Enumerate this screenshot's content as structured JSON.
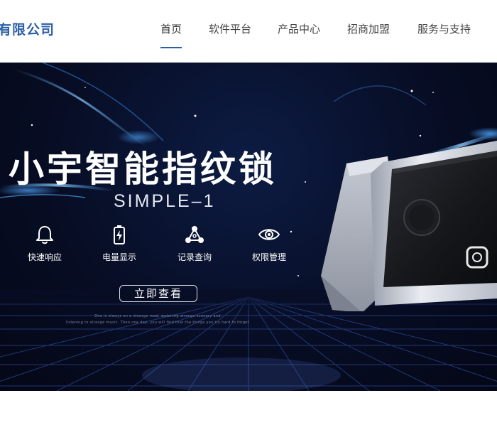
{
  "header": {
    "logo_text": "有限公司",
    "nav": [
      {
        "label": "首页",
        "active": true
      },
      {
        "label": "软件平台",
        "active": false
      },
      {
        "label": "产品中心",
        "active": false
      },
      {
        "label": "招商加盟",
        "active": false
      },
      {
        "label": "服务与支持",
        "active": false
      }
    ]
  },
  "hero": {
    "title": "小宇智能指纹锁",
    "subtitle": "SIMPLE–1",
    "features": [
      {
        "label": "快速响应",
        "icon": "bell-icon"
      },
      {
        "label": "电量显示",
        "icon": "battery-icon"
      },
      {
        "label": "记录查询",
        "icon": "share-nodes-icon"
      },
      {
        "label": "权限管理",
        "icon": "eye-icon"
      }
    ],
    "cta_label": "立即查看",
    "tagline_1": "One is always on a strange road, watching strange scenery and",
    "tagline_2": "listening to strange music. Then one day, you will find that the things you try hard to forget"
  },
  "colors": {
    "brand": "#2b5fa8",
    "hero_bg": "#070d24"
  }
}
